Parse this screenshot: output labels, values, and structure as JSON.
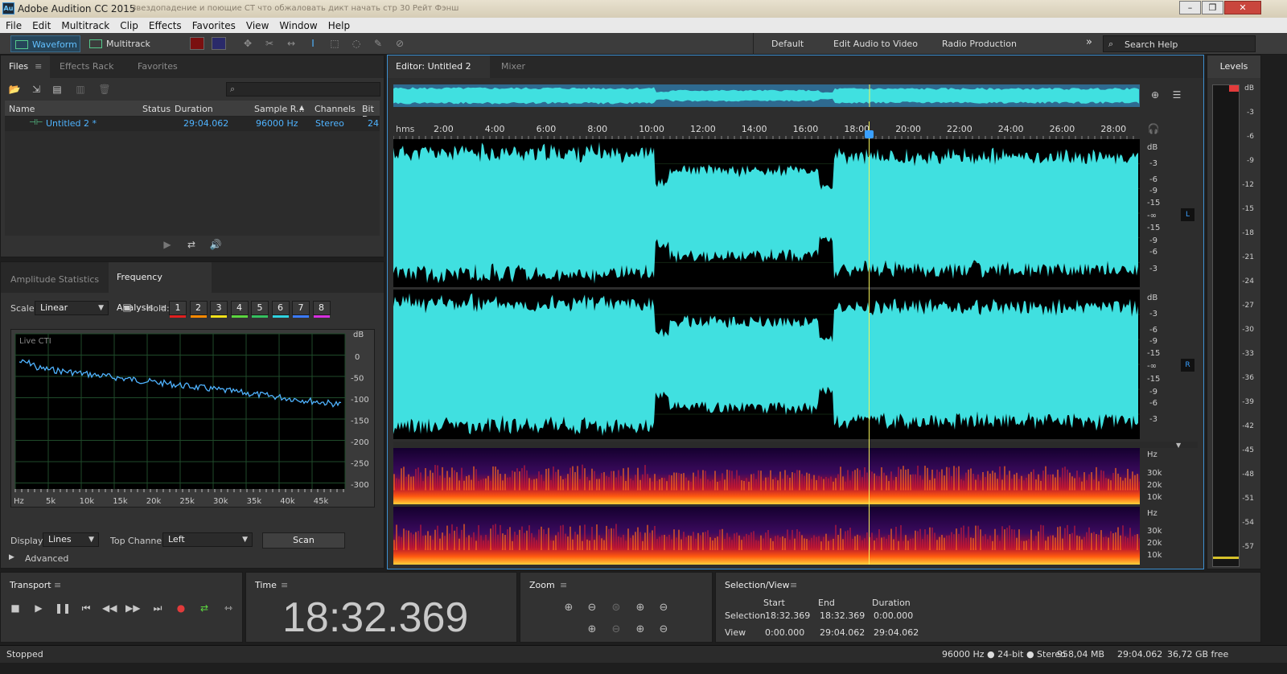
{
  "window": {
    "title": "Adobe Audition CC 2015",
    "subtitle": "Звездопадение и поющие СТ что обжаловать дикт начать стр 30 Рейт Фэнш"
  },
  "menu": [
    "File",
    "Edit",
    "Multitrack",
    "Clip",
    "Effects",
    "Favorites",
    "View",
    "Window",
    "Help"
  ],
  "toolbar": {
    "waveform": "Waveform",
    "multitrack": "Multitrack",
    "workspaces": [
      "Default",
      "Edit Audio to Video",
      "Radio Production"
    ],
    "more": "»",
    "search_placeholder": "Search Help"
  },
  "files": {
    "tabs": [
      "Files",
      "Effects Rack",
      "Favorites"
    ],
    "columns": [
      "Name",
      "Status",
      "Duration",
      "Sample R...",
      "Channels",
      "Bit D"
    ],
    "rows": [
      {
        "name": "Untitled 2 *",
        "status": "",
        "duration": "29:04.062",
        "sample_rate": "96000 Hz",
        "channels": "Stereo",
        "bit": "24"
      }
    ]
  },
  "analysis": {
    "tabs": [
      "Amplitude Statistics",
      "Frequency Analysis"
    ],
    "scale_label": "Scale:",
    "scale_value": "Linear",
    "hold_label": "Hold:",
    "hold_buttons": [
      "1",
      "2",
      "3",
      "4",
      "5",
      "6",
      "7",
      "8"
    ],
    "hold_colors": [
      "#e02020",
      "#ff8a00",
      "#f1e11a",
      "#5cd640",
      "#35c060",
      "#2fd3e0",
      "#3b7bff",
      "#d62fe0"
    ],
    "graph_label": "Live CTI",
    "db_label": "dB",
    "db_ticks": [
      "0",
      "-50",
      "-100",
      "-150",
      "-200",
      "-250",
      "-300"
    ],
    "hz_label": "Hz",
    "hz_ticks": [
      "5k",
      "10k",
      "15k",
      "20k",
      "25k",
      "30k",
      "35k",
      "40k",
      "45k"
    ],
    "display_label": "Display:",
    "display_value": "Lines",
    "channel_label": "Top Channel:",
    "channel_value": "Left",
    "scan": "Scan",
    "advanced": "Advanced"
  },
  "editor": {
    "tabs": [
      "Editor: Untitled 2 *",
      "Mixer"
    ],
    "ruler_unit": "hms",
    "ruler_ticks": [
      "2:00",
      "4:00",
      "6:00",
      "8:00",
      "10:00",
      "12:00",
      "14:00",
      "16:00",
      "18:00",
      "20:00",
      "22:00",
      "24:00",
      "26:00",
      "28:00"
    ],
    "db_label": "dB",
    "db_ticks_top": [
      "-3",
      "-6",
      "-9",
      "-15",
      "-∞",
      "-15",
      "-9",
      "-6",
      "-3"
    ],
    "channel_l": "L",
    "channel_r": "R",
    "hz_label": "Hz",
    "hz_ticks": [
      "30k",
      "20k",
      "10k"
    ],
    "waveform_color": "#40e0e0",
    "playhead_fraction": 0.638
  },
  "levels": {
    "title": "Levels",
    "ticks": [
      "dB",
      "-3",
      "-6",
      "-9",
      "-12",
      "-15",
      "-18",
      "-21",
      "-24",
      "-27",
      "-30",
      "-33",
      "-36",
      "-39",
      "-42",
      "-45",
      "-48",
      "-51",
      "-54",
      "-57"
    ]
  },
  "transport": {
    "title": "Transport"
  },
  "time": {
    "title": "Time",
    "value": "18:32.369"
  },
  "zoom": {
    "title": "Zoom"
  },
  "selection": {
    "title": "Selection/View",
    "headers": [
      "Start",
      "End",
      "Duration"
    ],
    "rows": [
      {
        "label": "Selection",
        "start": "18:32.369",
        "end": "18:32.369",
        "duration": "0:00.000"
      },
      {
        "label": "View",
        "start": "0:00.000",
        "end": "29:04.062",
        "duration": "29:04.062"
      }
    ]
  },
  "status": {
    "left": "Stopped",
    "format": "96000 Hz ● 24-bit ● Stereo",
    "size": "958,04 MB",
    "duration": "29:04.062",
    "free": "36,72 GB free"
  }
}
